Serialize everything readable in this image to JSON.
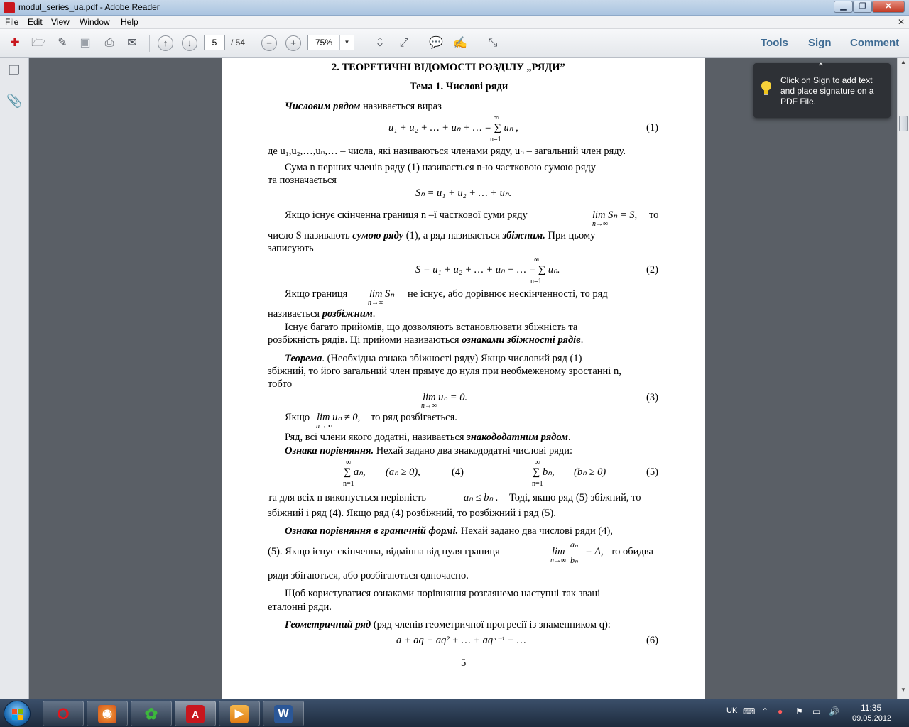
{
  "window": {
    "title": "modul_series_ua.pdf - Adobe Reader"
  },
  "menu": {
    "file": "File",
    "edit": "Edit",
    "view": "View",
    "window": "Window",
    "help": "Help"
  },
  "toolbar": {
    "page_current": "5",
    "page_total": "/ 54",
    "zoom": "75%",
    "tools": "Tools",
    "sign": "Sign",
    "comment": "Comment"
  },
  "tooltip": {
    "text": "Click on Sign to add text and place signature on a PDF File."
  },
  "pdf": {
    "heading": "2. ТЕОРЕТИЧНІ ВІДОМОСТІ РОЗДІЛУ „РЯДИ”",
    "topic": "Тема 1. Числові ряди",
    "p1_term": "Числовим рядом",
    "p1_rest": " називається вираз",
    "eq1": "u₁ + u₂ + … + uₙ + … = ∑ uₙ ,",
    "eq1_sum_top": "∞",
    "eq1_sum_bottom": "n=1",
    "eq1_num": "(1)",
    "p2": "де u₁,u₂,…,uₙ,… – числа, які називаються членами ряду, uₙ – загальний член ряду.",
    "p3_line1": "Сума n перших членів ряду (1) називається n-ю частковою сумою ряду",
    "p3_line2": "та позначається",
    "eq_sn": "Sₙ = u₁ + u₂ + … + uₙ.",
    "p4_line1_a": "Якщо існує скінченна границя n –ї часткової суми ряду",
    "p4_lim": "lim Sₙ = S,",
    "p4_lim_sub": "n→∞",
    "p4_line1_b": "то",
    "p4_line2_a": "число S називають ",
    "p4_line2_term": "сумою ряду",
    "p4_line2_b": " (1), а ряд називається ",
    "p4_line2_term2": "збіжним.",
    "p4_line2_c": " При цьому",
    "p4_line3": "записують",
    "eq2": "S = u₁ + u₂ + … + uₙ + … = ∑ uₙ.",
    "eq2_sum_top": "∞",
    "eq2_sum_bottom": "n=1",
    "eq2_num": "(2)",
    "p5_line1_a": "Якщо границя",
    "p5_lim": "lim Sₙ",
    "p5_lim_sub": "n→∞",
    "p5_line1_b": "не існує, або дорівнює нескінченності, то ряд",
    "p5_line2_a": "називається ",
    "p5_line2_term": "розбіжним",
    "p5_line2_b": ".",
    "p6_line1": "Існує багато прийомів, що дозволяють встановлювати збіжність та",
    "p6_line2_a": "розбіжність рядів. Ці прийоми називаються ",
    "p6_line2_term": "ознаками збіжності рядів",
    "p6_line2_b": ".",
    "p7_term": "Теорема",
    "p7_line1": ". (Необхідна ознака збіжності ряду) Якщо числовий ряд (1)",
    "p7_line2": "збіжний, то його загальний член прямує до нуля при необмеженому зростанні n,",
    "p7_line3": "тобто",
    "eq3": "lim uₙ = 0.",
    "eq3_sub": "n→∞",
    "eq3_num": "(3)",
    "p8_a": "Якщо",
    "p8_lim": "lim uₙ ≠ 0,",
    "p8_lim_sub": "n→∞",
    "p8_b": "то ряд розбігається.",
    "p9_a": "Ряд, всі члени якого додатні, називається ",
    "p9_term": "знакододатним рядом",
    "p9_b": ".",
    "p10_term": "Ознака порівняння.",
    "p10_rest": " Нехай задано два знакододатні числові ряди:",
    "eq4": "∑ aₙ,",
    "eq4_cond": "(aₙ ≥ 0),",
    "eq4_num": "(4)",
    "eq5": "∑ bₙ,",
    "eq5_cond": "(bₙ ≥ 0)",
    "eq5_num": "(5)",
    "sum_top": "∞",
    "sum_bottom": "n=1",
    "p11_line1_a": "та для всіх n виконується нерівність",
    "p11_ineq": "aₙ ≤ bₙ .",
    "p11_line1_b": "Тоді, якщо ряд (5) збіжний, то",
    "p11_line2": "збіжний і ряд (4). Якщо ряд (4) розбіжний, то розбіжний і ряд (5).",
    "p12_term": "Ознака порівняння в граничній формі.",
    "p12_rest": " Нехай задано два числові ряди (4),",
    "p12_line2_a": "(5). Якщо існує скінченна, відмінна від нуля границя",
    "p12_lim": "lim",
    "p12_frac_num": "aₙ",
    "p12_frac_den": "bₙ",
    "p12_eq": "= A,",
    "p12_lim_sub": "n→∞",
    "p12_line2_b": "то обидва",
    "p12_line3": "ряди збігаються, або розбігаються одночасно.",
    "p13_line1": "Щоб користуватися ознаками порівняння розглянемо наступні так звані",
    "p13_line2": "еталонні ряди.",
    "p14_term": "Геометричний ряд",
    "p14_rest": " (ряд членів геометричної прогресії із знаменником q):",
    "eq6": "a + aq + aq² + … + aqⁿ⁻¹ + …",
    "eq6_num": "(6)",
    "page_number": "5"
  },
  "taskbar": {
    "lang": "UK",
    "time": "11:35",
    "date": "09.05.2012"
  },
  "colors": {
    "accent_link": "#3e6b93",
    "pdf_icon": "#c8161d"
  }
}
